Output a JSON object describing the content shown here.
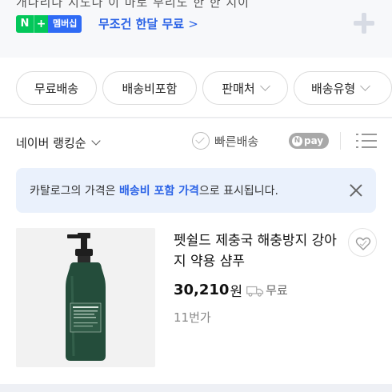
{
  "promo": {
    "cut_text": "개나리나 지도나 이 마로 무리도 한 한 지이",
    "npay_letter": "N",
    "plus_symbol": "+",
    "member_label": "멤버십",
    "link_text": "무조건 한달 무료",
    "link_chevron": ">"
  },
  "filters": [
    {
      "label": "무료배송",
      "dropdown": false
    },
    {
      "label": "배송비포함",
      "dropdown": false
    },
    {
      "label": "판매처",
      "dropdown": true
    },
    {
      "label": "배송유형",
      "dropdown": true
    }
  ],
  "sortbar": {
    "sort_label": "네이버 랭킹순",
    "fast_delivery_label": "빠른배송",
    "npay_n": "N",
    "npay_text": "pay"
  },
  "notice": {
    "text_before": "카탈로그의 가격은 ",
    "text_highlight": "배송비 포함 가격",
    "text_after": "으로 표시됩니다."
  },
  "product": {
    "name": "펫쉴드 제충국 해충방지 강아지 약용 샴푸",
    "price": "30,210",
    "currency": "원",
    "shipping": "무료",
    "sellers": "11번가",
    "image_label": "펫쉴드 제충국 샴푸"
  },
  "colors": {
    "accent_blue": "#2b63e6",
    "npay_green": "#03c75a",
    "member_blue": "#2f6bf5",
    "notice_bg": "#eaf1fc",
    "bottle_green": "#244d3b"
  }
}
